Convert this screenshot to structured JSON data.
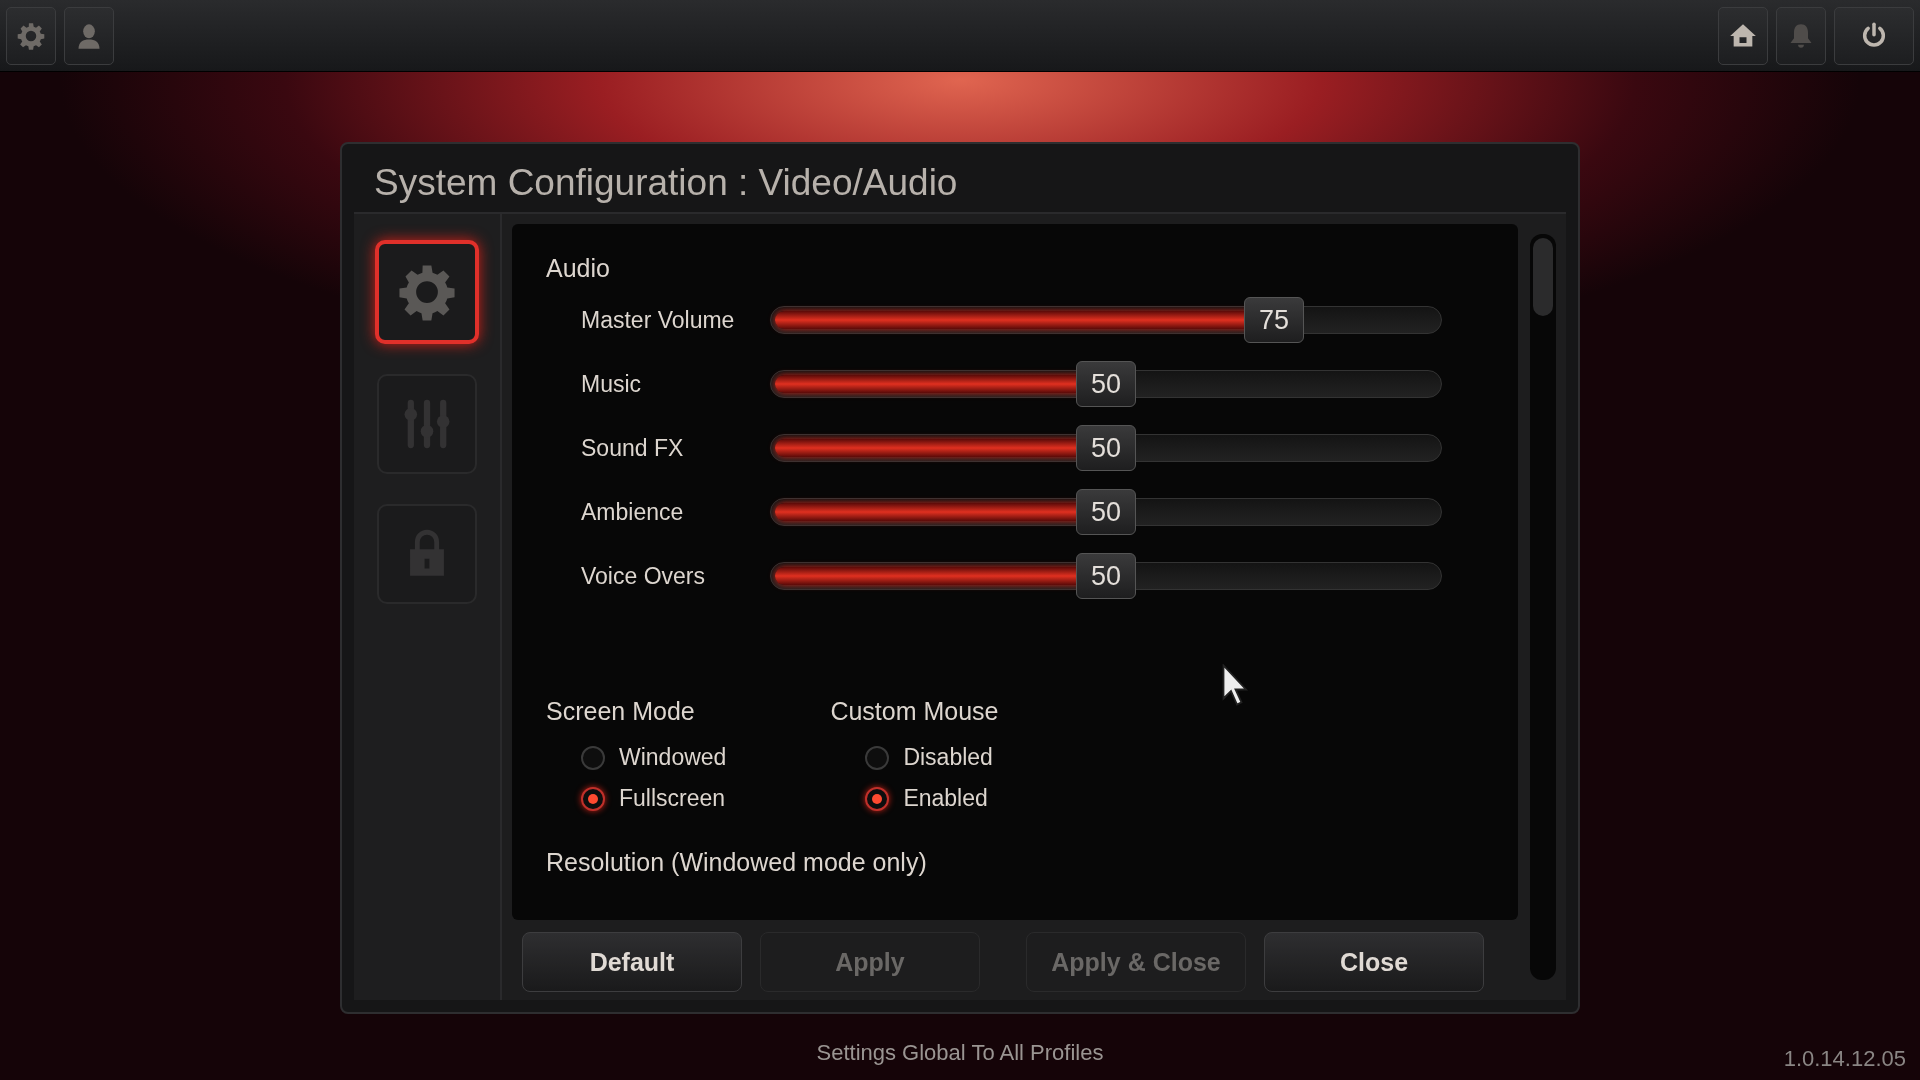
{
  "top_bar": {
    "left_buttons": [
      {
        "kind": "gear"
      },
      {
        "kind": "person"
      }
    ],
    "right_buttons": [
      {
        "kind": "home",
        "disabled": false
      },
      {
        "kind": "bell",
        "disabled": true
      },
      {
        "kind": "power",
        "disabled": false
      }
    ]
  },
  "dialog": {
    "title": "System Configuration : Video/Audio",
    "sidebar": {
      "items": [
        {
          "kind": "gear",
          "selected": true
        },
        {
          "kind": "sliders",
          "selected": false
        },
        {
          "kind": "lock",
          "selected": false
        }
      ]
    },
    "audio": {
      "heading": "Audio",
      "sliders": [
        {
          "label": "Master Volume",
          "level": 0.75,
          "reading": "75"
        },
        {
          "label": "Music",
          "level": 0.5,
          "reading": "50"
        },
        {
          "label": "Sound FX",
          "level": 0.5,
          "reading": "50"
        },
        {
          "label": "Ambience",
          "level": 0.5,
          "reading": "50"
        },
        {
          "label": "Voice Overs",
          "level": 0.5,
          "reading": "50"
        }
      ]
    },
    "radio_groups": [
      {
        "heading": "Screen Mode",
        "options": [
          {
            "label": "Windowed",
            "selected": false
          },
          {
            "label": "Fullscreen",
            "selected": true
          }
        ]
      },
      {
        "heading": "Custom Mouse",
        "options": [
          {
            "label": "Disabled",
            "selected": false
          },
          {
            "label": "Enabled",
            "selected": true
          }
        ]
      }
    ],
    "resolution_heading": "Resolution (Windowed mode only)",
    "buttons": [
      {
        "label": "Default",
        "disabled": false
      },
      {
        "label": "Apply",
        "disabled": true
      },
      {
        "label": "Apply & Close",
        "disabled": true
      },
      {
        "label": "Close",
        "disabled": false
      }
    ]
  },
  "footer": "Settings Global To All Profiles",
  "version": "1.0.14.12.05"
}
